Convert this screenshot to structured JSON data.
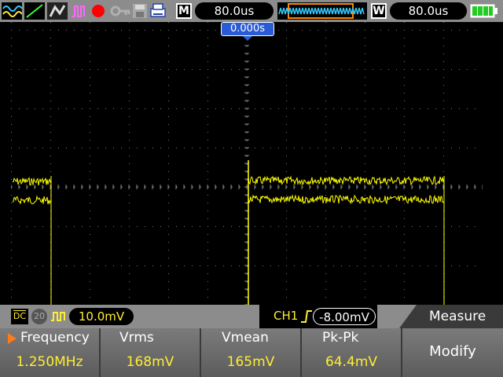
{
  "topbar": {
    "icons": [
      "waveform-mode-icon",
      "vector-mode-icon",
      "persist-mode-icon",
      "pulse-mode-icon",
      "record-icon",
      "key-icon",
      "save-icon",
      "print-icon",
      "battery-icon"
    ],
    "main_timebase_label": "M",
    "main_timebase_value": "80.0us",
    "window_label": "W",
    "window_timebase_value": "80.0us"
  },
  "screen": {
    "trigger_time": "0.000s"
  },
  "statusbar": {
    "coupling": "DC",
    "bandwidth_limit": "20",
    "channel_scale": "10.0mV",
    "trigger_source": "CH1",
    "trigger_level": "-8.00mV",
    "menu_title": "Measure"
  },
  "measurements": [
    {
      "label": "Frequency",
      "value": "1.250MHz",
      "selected": true
    },
    {
      "label": "Vrms",
      "value": "168mV"
    },
    {
      "label": "Vmean",
      "value": "165mV"
    },
    {
      "label": "Pk-Pk",
      "value": "64.4mV"
    }
  ],
  "modify_label": "Modify",
  "colors": {
    "trace": "#ffff00",
    "value": "#ffee33",
    "bar": "#8c8c8c",
    "marker": "#2a5bd7"
  }
}
